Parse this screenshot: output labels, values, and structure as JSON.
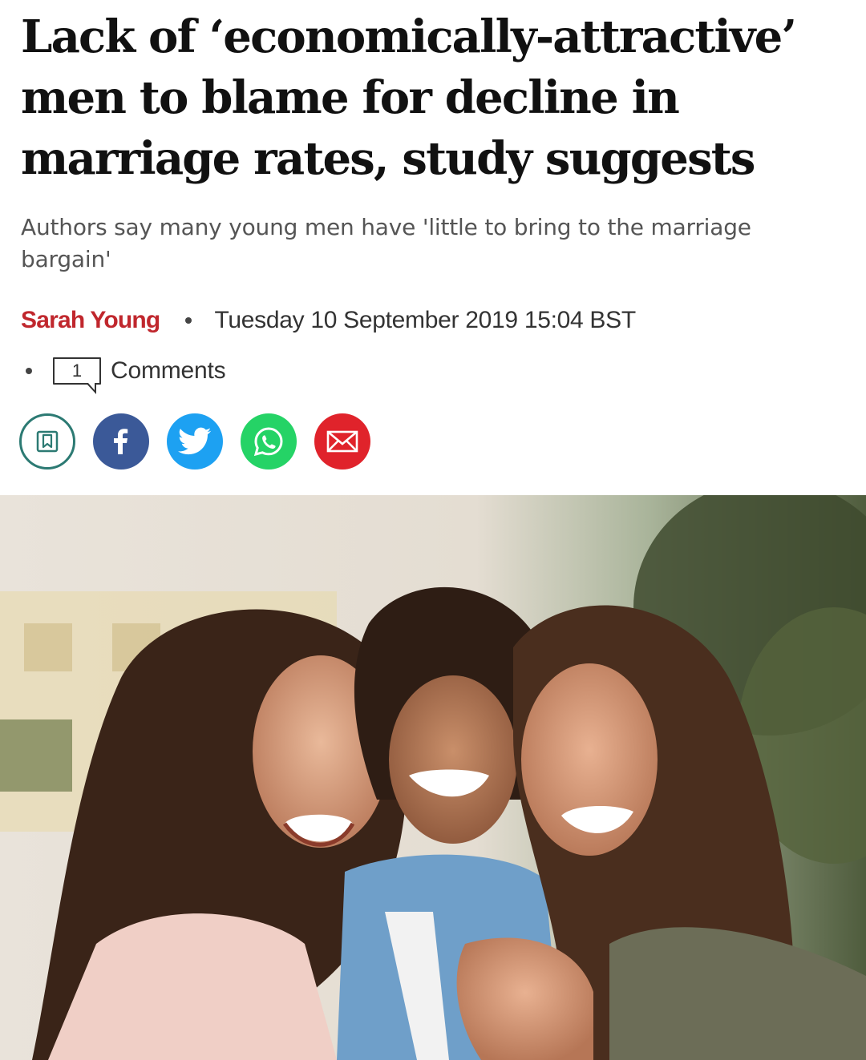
{
  "article": {
    "headline": "Lack of ‘economically-attractive’ men to blame for decline in marriage rates, study suggests",
    "standfirst": "Authors say many young men have 'little to bring to the marriage bargain'",
    "author": "Sarah Young",
    "date": "Tuesday 10 September 2019 15:04 BST",
    "comment_count": "1",
    "comments_label": "Comments"
  },
  "share": {
    "buttons": [
      {
        "name": "bookmark",
        "icon": "bookmark-icon",
        "color": "#2c7a73"
      },
      {
        "name": "facebook",
        "icon": "facebook-icon",
        "color": "#3b5998"
      },
      {
        "name": "twitter",
        "icon": "twitter-icon",
        "color": "#1da1f2"
      },
      {
        "name": "whatsapp",
        "icon": "whatsapp-icon",
        "color": "#25d366"
      },
      {
        "name": "email",
        "icon": "mail-icon",
        "color": "#e0232b"
      }
    ]
  },
  "colors": {
    "author_red": "#c0272d",
    "headline": "#111111",
    "standfirst": "#555555"
  }
}
